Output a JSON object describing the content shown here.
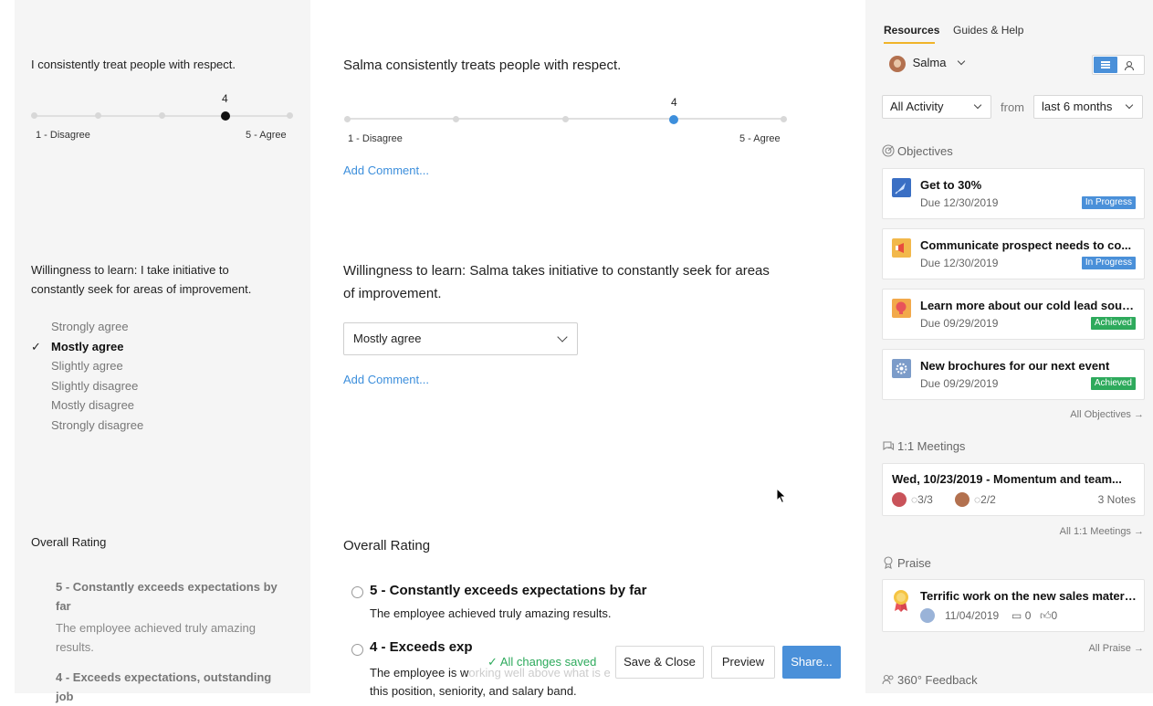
{
  "left": {
    "q1": {
      "text": "I consistently treat people with respect.",
      "value": "4",
      "min_label": "1 - Disagree",
      "max_label": "5 - Agree"
    },
    "q2": {
      "text": "Willingness to learn: I take initiative to constantly seek for areas of improvement.",
      "options": [
        "Strongly agree",
        "Mostly agree",
        "Slightly agree",
        "Slightly disagree",
        "Mostly disagree",
        "Strongly disagree"
      ],
      "selected": "Mostly agree"
    },
    "overall": {
      "title": "Overall Rating",
      "items": [
        {
          "title": "5 - Constantly exceeds expectations by far",
          "desc": "The employee achieved truly amazing results."
        },
        {
          "title": "4 - Exceeds expectations, outstanding job",
          "desc": ""
        }
      ]
    }
  },
  "main": {
    "q1": {
      "text": "Salma consistently treats people with respect.",
      "value": "4",
      "min_label": "1 - Disagree",
      "max_label": "5 - Agree",
      "comment_link": "Add Comment..."
    },
    "q2": {
      "text": "Willingness to learn: Salma takes initiative to constantly seek for areas of improvement.",
      "select_value": "Mostly agree",
      "comment_link": "Add Comment..."
    },
    "overall": {
      "title": "Overall Rating",
      "items": [
        {
          "title": "5 - Constantly exceeds expectations by far",
          "desc": "The employee achieved truly amazing results."
        },
        {
          "title": "4 - Exceeds exp",
          "desc_start": "The employee is w",
          "desc_mid": "orking well above what is e",
          "desc_end": "this position, seniority, and salary band."
        }
      ]
    },
    "toolbar": {
      "saved": "All changes saved",
      "save_close": "Save & Close",
      "preview": "Preview",
      "share": "Share..."
    }
  },
  "sidebar": {
    "tabs": [
      "Resources",
      "Guides & Help"
    ],
    "person": "Salma",
    "activity": "All Activity",
    "from": "from",
    "range": "last 6 months",
    "objectives": {
      "title": "Objectives",
      "items": [
        {
          "title": "Get to 30%",
          "due": "Due 12/30/2019",
          "status": "In Progress",
          "color": "#3a6fc4"
        },
        {
          "title": "Communicate prospect needs to co...",
          "due": "Due 12/30/2019",
          "status": "In Progress",
          "color": "#f2b84b"
        },
        {
          "title": "Learn more about our cold lead sourc...",
          "due": "Due 09/29/2019",
          "status": "Achieved",
          "color": "#f2a94b"
        },
        {
          "title": "New brochures for our next event",
          "due": "Due 09/29/2019",
          "status": "Achieved",
          "color": "#7c9cc9"
        }
      ],
      "all_link": "All Objectives →"
    },
    "meetings": {
      "title": "1:1 Meetings",
      "item": {
        "title": "Wed, 10/23/2019 - Momentum and team...",
        "a": "3/3",
        "b": "2/2",
        "notes": "3 Notes"
      },
      "all_link": "All 1:1 Meetings →"
    },
    "praise": {
      "title": "Praise",
      "item": {
        "title": "Terrific work on the new sales material",
        "date": "11/04/2019",
        "comments": "0",
        "likes": "0"
      },
      "all_link": "All Praise →"
    },
    "feedback": {
      "title": "360° Feedback"
    }
  }
}
